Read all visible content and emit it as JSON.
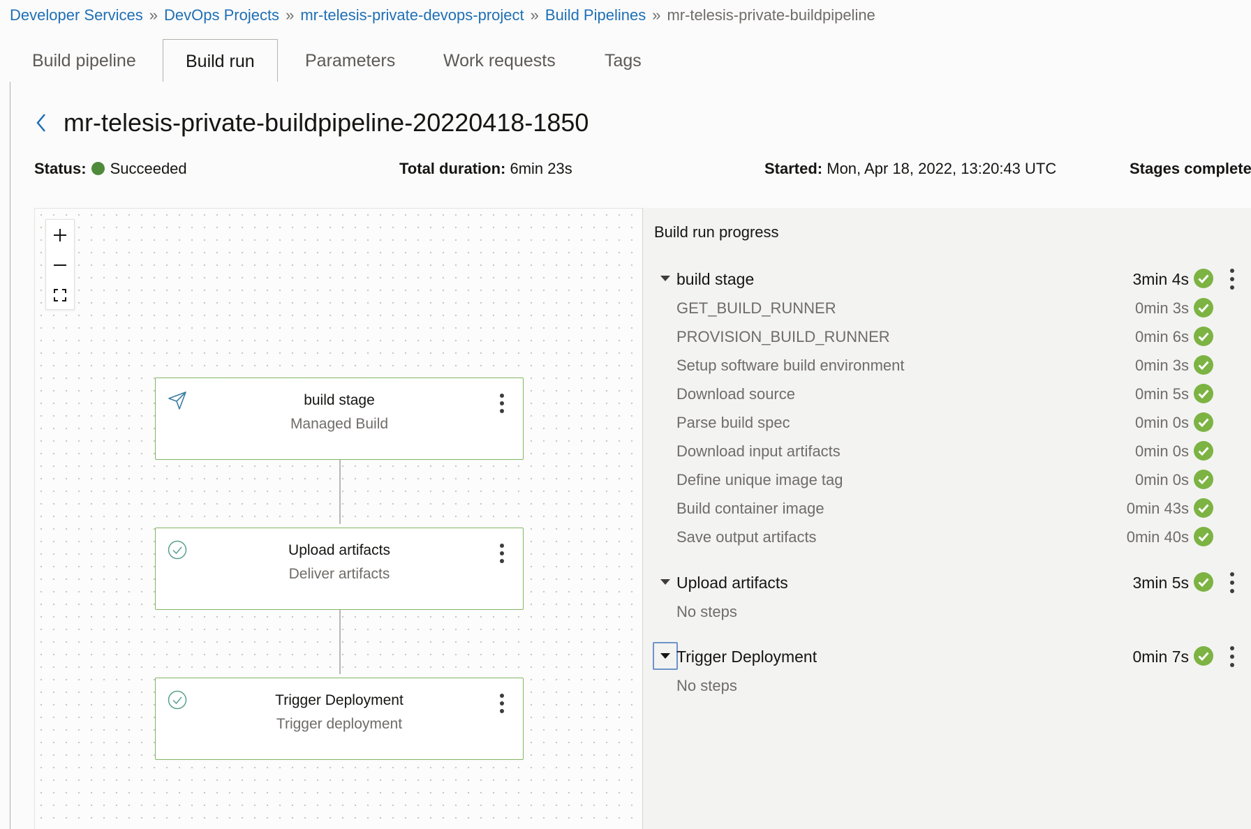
{
  "breadcrumb": {
    "items": [
      "Developer Services",
      "DevOps Projects",
      "mr-telesis-private-devops-project",
      "Build Pipelines"
    ],
    "separator": "»",
    "current": "mr-telesis-private-buildpipeline"
  },
  "tabs": [
    "Build pipeline",
    "Build run",
    "Parameters",
    "Work requests",
    "Tags"
  ],
  "active_tab": "Build run",
  "title": "mr-telesis-private-buildpipeline-20220418-1850",
  "summary": {
    "status_label": "Status:",
    "status_value": "Succeeded",
    "duration_label": "Total duration:",
    "duration_value": "6min 23s",
    "started_label": "Started:",
    "started_value": "Mon, Apr 18, 2022, 13:20:43 UTC",
    "stages_label": "Stages complete"
  },
  "colors": {
    "success": "#7cb342",
    "status_dot": "#4e8a3a",
    "link": "#1f6fb5",
    "node_border": "#82b561"
  },
  "canvas": {
    "nodes": [
      {
        "title": "build stage",
        "subtitle": "Managed Build",
        "icon": "send-icon"
      },
      {
        "title": "Upload artifacts",
        "subtitle": "Deliver artifacts",
        "icon": "check-circle-icon"
      },
      {
        "title": "Trigger Deployment",
        "subtitle": "Trigger deployment",
        "icon": "check-circle-icon"
      }
    ]
  },
  "progress": {
    "title": "Build run progress",
    "stages": [
      {
        "name": "build stage",
        "duration": "3min 4s",
        "steps": [
          {
            "name": "GET_BUILD_RUNNER",
            "duration": "0min 3s"
          },
          {
            "name": "PROVISION_BUILD_RUNNER",
            "duration": "0min 6s"
          },
          {
            "name": "Setup software build environment",
            "duration": "0min 3s"
          },
          {
            "name": "Download source",
            "duration": "0min 5s"
          },
          {
            "name": "Parse build spec",
            "duration": "0min 0s"
          },
          {
            "name": "Download input artifacts",
            "duration": "0min 0s"
          },
          {
            "name": "Define unique image tag",
            "duration": "0min 0s"
          },
          {
            "name": "Build container image",
            "duration": "0min 43s"
          },
          {
            "name": "Save output artifacts",
            "duration": "0min 40s"
          }
        ]
      },
      {
        "name": "Upload artifacts",
        "duration": "3min 5s",
        "no_steps": "No steps"
      },
      {
        "name": "Trigger Deployment",
        "duration": "0min 7s",
        "no_steps": "No steps"
      }
    ]
  }
}
